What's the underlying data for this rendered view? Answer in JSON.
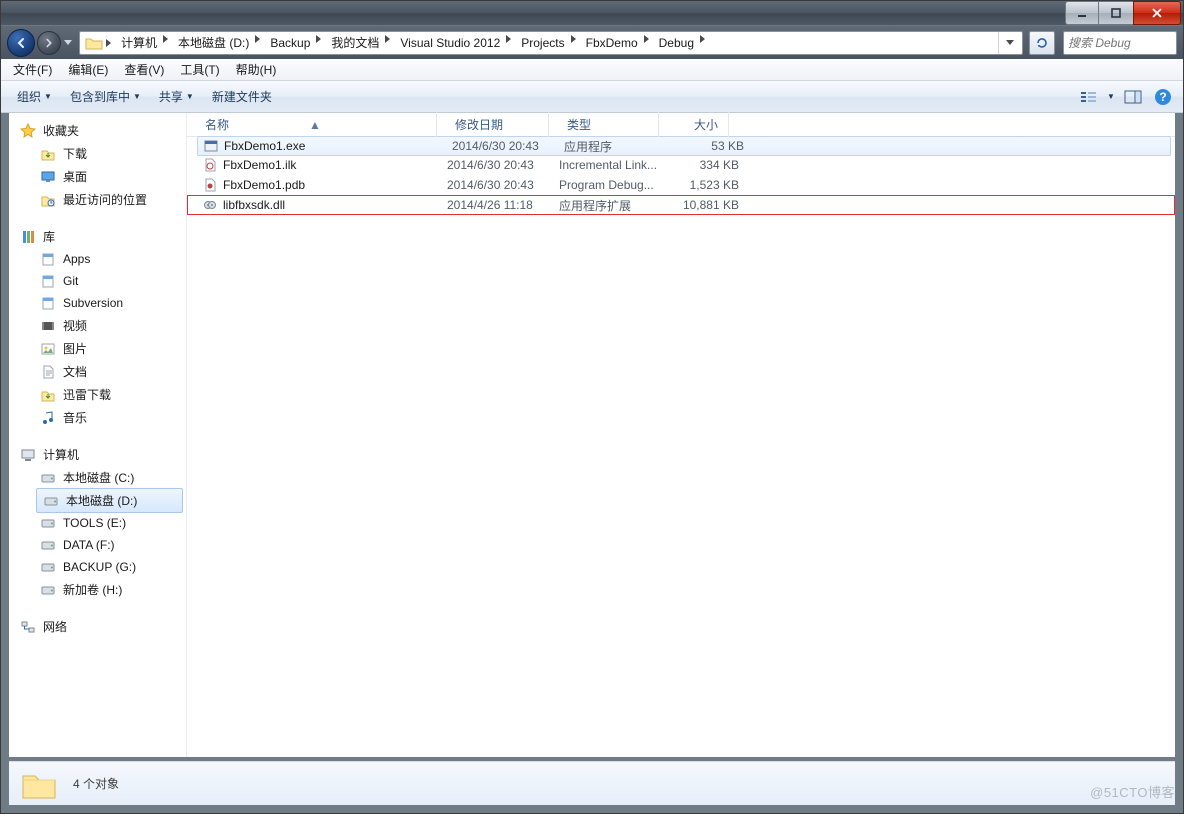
{
  "window_buttons": {
    "min": "min",
    "max": "max",
    "close": "close"
  },
  "breadcrumb": [
    "计算机",
    "本地磁盘 (D:)",
    "Backup",
    "我的文档",
    "Visual Studio 2012",
    "Projects",
    "FbxDemo",
    "Debug"
  ],
  "search_placeholder": "搜索 Debug",
  "menu": [
    "文件(F)",
    "编辑(E)",
    "查看(V)",
    "工具(T)",
    "帮助(H)"
  ],
  "commands": {
    "organize": "组织",
    "include": "包含到库中",
    "share": "共享",
    "newfolder": "新建文件夹"
  },
  "sidebar": {
    "favorites": {
      "label": "收藏夹",
      "items": [
        "下载",
        "桌面",
        "最近访问的位置"
      ]
    },
    "libraries": {
      "label": "库",
      "items": [
        "Apps",
        "Git",
        "Subversion",
        "视频",
        "图片",
        "文档",
        "迅雷下载",
        "音乐"
      ]
    },
    "computer": {
      "label": "计算机",
      "items": [
        "本地磁盘 (C:)",
        "本地磁盘 (D:)",
        "TOOLS (E:)",
        "DATA (F:)",
        "BACKUP (G:)",
        "新加卷 (H:)"
      ],
      "selected": 1
    },
    "network": {
      "label": "网络"
    }
  },
  "columns": {
    "name": "名称",
    "date": "修改日期",
    "type": "类型",
    "size": "大小"
  },
  "files": [
    {
      "icon": "exe",
      "name": "FbxDemo1.exe",
      "date": "2014/6/30 20:43",
      "type": "应用程序",
      "size": "53 KB",
      "selected": true,
      "highlight": false
    },
    {
      "icon": "ilk",
      "name": "FbxDemo1.ilk",
      "date": "2014/6/30 20:43",
      "type": "Incremental Link...",
      "size": "334 KB",
      "selected": false,
      "highlight": false
    },
    {
      "icon": "pdb",
      "name": "FbxDemo1.pdb",
      "date": "2014/6/30 20:43",
      "type": "Program Debug...",
      "size": "1,523 KB",
      "selected": false,
      "highlight": false
    },
    {
      "icon": "dll",
      "name": "libfbxsdk.dll",
      "date": "2014/4/26 11:18",
      "type": "应用程序扩展",
      "size": "10,881 KB",
      "selected": false,
      "highlight": true
    }
  ],
  "status": "4 个对象",
  "watermark": "@51CTO博客"
}
